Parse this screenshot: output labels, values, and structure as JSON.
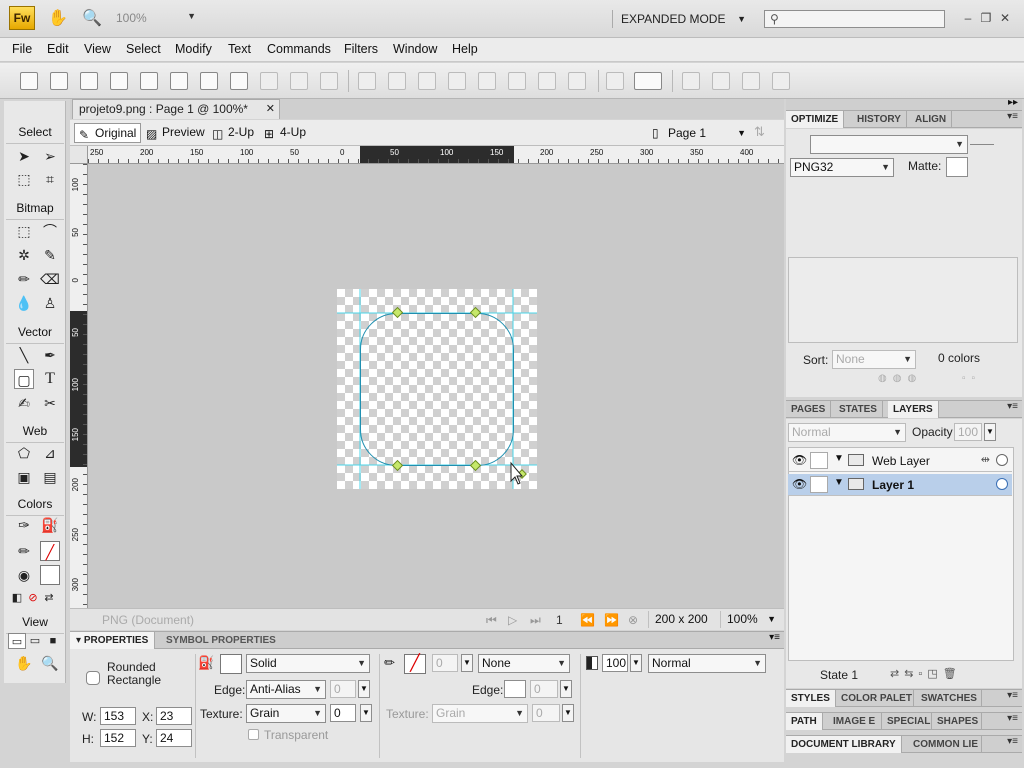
{
  "app": {
    "logo": "Fw",
    "zoom": "100%",
    "mode": "EXPANDED MODE",
    "search_placeholder": ""
  },
  "menu": [
    "File",
    "Edit",
    "View",
    "Select",
    "Modify",
    "Text",
    "Commands",
    "Filters",
    "Window",
    "Help"
  ],
  "document": {
    "tab_title": "projeto9.png : Page 1 @ 100%*",
    "views": [
      "Original",
      "Preview",
      "2-Up",
      "4-Up"
    ],
    "page": "Page 1",
    "status_doc": "PNG (Document)",
    "status_page": "1",
    "status_size": "200 x 200",
    "status_zoom": "100%"
  },
  "ruler": {
    "h_labels": [
      "250",
      "200",
      "150",
      "100",
      "50",
      "0",
      "50",
      "100",
      "150",
      "200",
      "250",
      "300",
      "350",
      "400"
    ],
    "v_labels": [
      "100",
      "50",
      "0",
      "50",
      "100",
      "150",
      "200",
      "250",
      "300"
    ]
  },
  "tools": {
    "sections": [
      "Select",
      "Bitmap",
      "Vector",
      "Web",
      "Colors",
      "View"
    ]
  },
  "properties": {
    "tabs": [
      "PROPERTIES",
      "SYMBOL PROPERTIES"
    ],
    "object_name": "Rounded Rectangle",
    "w_label": "W:",
    "w": "153",
    "h_label": "H:",
    "h": "152",
    "x_label": "X:",
    "x": "23",
    "y_label": "Y:",
    "y": "24",
    "fill_type": "Solid",
    "edge_label": "Edge:",
    "edge": "Anti-Alias",
    "edge_val": "0",
    "texture_label": "Texture:",
    "texture": "Grain",
    "texture_val": "0",
    "transparent": "Transparent",
    "stroke_size": "0",
    "stroke_type": "None",
    "stroke_edge_label": "Edge:",
    "stroke_edge_val": "0",
    "stroke_texture_label": "Texture:",
    "stroke_texture": "Grain",
    "stroke_texture_val": "0",
    "opacity": "100",
    "blend": "Normal"
  },
  "optimize": {
    "tabs": [
      "OPTIMIZE",
      "HISTORY",
      "ALIGN"
    ],
    "format": "PNG32",
    "matte_label": "Matte:",
    "sort_label": "Sort:",
    "sort": "None",
    "colors": "0 colors"
  },
  "layers": {
    "tabs": [
      "PAGES",
      "STATES",
      "LAYERS"
    ],
    "blend": "Normal",
    "opacity_label": "Opacity",
    "opacity": "100",
    "rows": [
      {
        "name": "Web Layer"
      },
      {
        "name": "Layer 1"
      }
    ],
    "state": "State 1"
  },
  "bottom_panels": {
    "row1": [
      "STYLES",
      "COLOR PALET",
      "SWATCHES"
    ],
    "row2": [
      "PATH",
      "IMAGE E",
      "SPECIAL",
      "SHAPES"
    ],
    "row3": [
      "DOCUMENT LIBRARY",
      "COMMON LIE"
    ]
  }
}
